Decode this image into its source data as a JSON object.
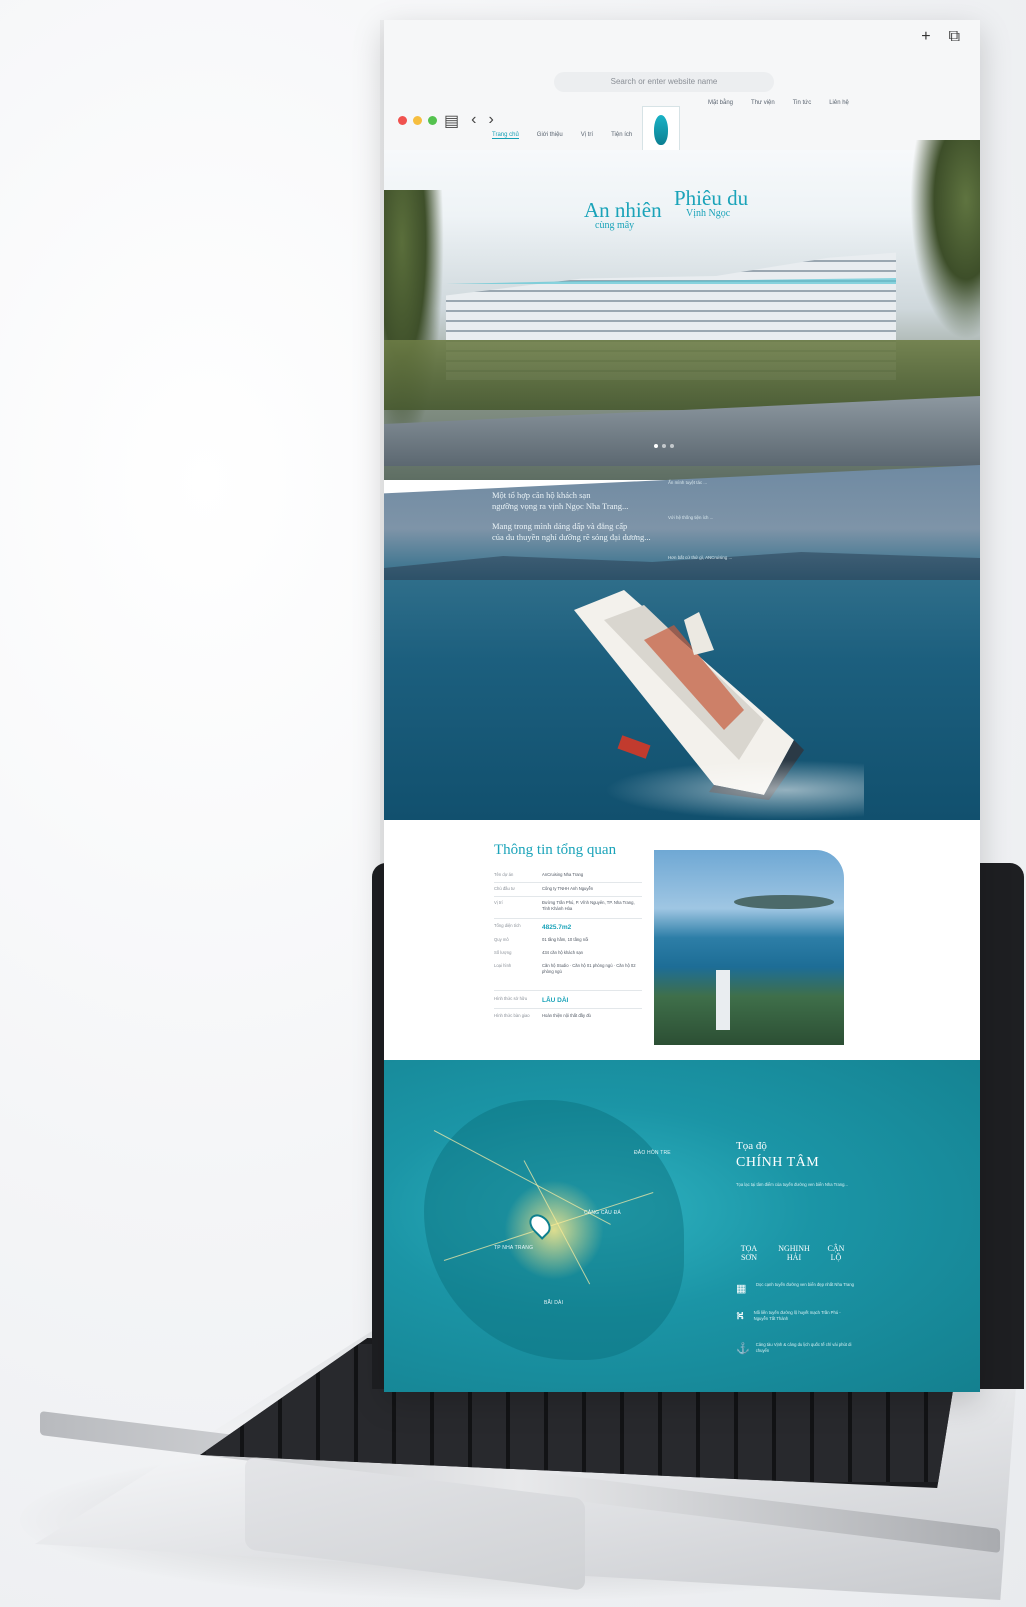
{
  "browser": {
    "address_placeholder": "Search or enter website name",
    "new_tab_icon": "plus-icon",
    "tabs_icon": "tabs-icon"
  },
  "site": {
    "nav_left": [
      "Trang chủ",
      "Giới thiệu",
      "Vị trí",
      "Tiện ích"
    ],
    "nav_right": [
      "Mặt bằng",
      "Thư viện",
      "Tin tức",
      "Liên hệ"
    ],
    "active_nav": 0
  },
  "hero": {
    "title_left": "An nhiên",
    "sub_left": "cùng mây",
    "title_right": "Phiêu du",
    "sub_right": "Vịnh Ngọc"
  },
  "sea": {
    "line1": "Một tổ hợp căn hộ khách sạn",
    "line2": "ngưỡng vọng ra vịnh Ngọc Nha Trang...",
    "line3": "Mang trong mình dáng dấp và đẳng cấp",
    "line4": "của du thuyền nghỉ dưỡng rẽ sóng đại dương...",
    "para1": "Ẩn mình tuyệt tác ...",
    "para2": "Với hệ thống tiện ích ...",
    "para3": "Hơn bất cứ thứ gì, ANCruising ..."
  },
  "overview": {
    "title": "Thông tin tổng quan",
    "rows": [
      {
        "key": "Tên dự án",
        "val": "AnCruising Nha Trang",
        "big": false
      },
      {
        "key": "Chủ đầu tư",
        "val": "Công ty TNHH Anh Nguyễn",
        "big": false
      },
      {
        "key": "Vị trí",
        "val": "Đường Trần Phú, P. Vĩnh Nguyên, TP. Nha Trang, Tỉnh Khánh Hòa",
        "big": false
      },
      {
        "key": "Tổng diện tích",
        "val": "4825.7m2",
        "big": true
      },
      {
        "key": "Quy mô",
        "val": "01 tầng hầm, 10 tầng nổi",
        "big": false
      },
      {
        "key": "Số lượng",
        "val": "434 căn hộ khách sạn",
        "big": false
      },
      {
        "key": "Loại hình",
        "val": "Căn hộ Studio · Căn hộ 01 phòng ngủ · Căn hộ 02 phòng ngủ",
        "big": false
      },
      {
        "key": "Hình thức sở hữu",
        "val": "LÂU DÀI",
        "big": true
      },
      {
        "key": "Hình thức bàn giao",
        "val": "Hoàn thiện nội thất đầy đủ",
        "big": false
      }
    ]
  },
  "map": {
    "title": "Tọa độ",
    "title_big": "CHÍNH TÂM",
    "description": "Tọa lạc tại tâm điểm của tuyến đường ven biển Nha Trang...",
    "triad": [
      "TỌA SƠN",
      "NGHINH HẢI",
      "CẬN LỘ"
    ],
    "features": [
      {
        "icon": "building-icon",
        "text": "Dọc cạnh tuyến đường ven biển đẹp nhất Nha Trang"
      },
      {
        "icon": "road-icon",
        "text": "Nối liền tuyến đường lộ huyết mạch Trần Phú - Nguyễn Tất Thành"
      },
      {
        "icon": "anchor-icon",
        "text": "Cảng tàu Vịnh & cảng du lịch quốc tế chỉ vài phút di chuyển"
      }
    ],
    "labels": {
      "island": "ĐẢO HÒN TRE",
      "port": "CẢNG CẦU ĐÁ",
      "center": "TP NHA TRANG",
      "south": "BÃI DÀI"
    }
  },
  "colors": {
    "accent": "#1aa3b9",
    "map_teal": "#14808f"
  }
}
